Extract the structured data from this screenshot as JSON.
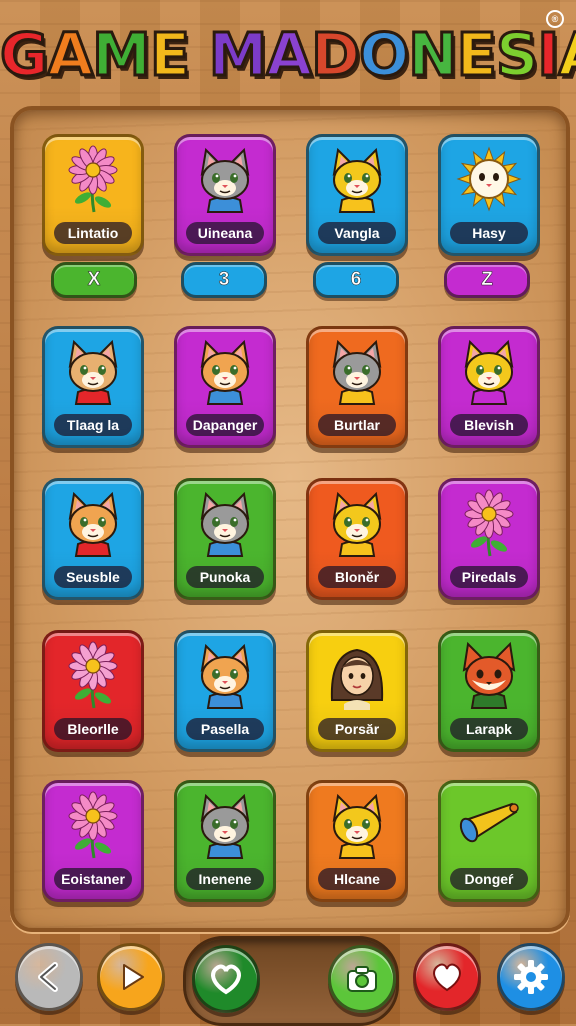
{
  "title": {
    "letters": [
      {
        "ch": "G",
        "color": "#e8262b"
      },
      {
        "ch": "A",
        "color": "#f07d1e"
      },
      {
        "ch": "M",
        "color": "#3fae35"
      },
      {
        "ch": "E",
        "color": "#f2b81b"
      },
      {
        "ch": " ",
        "color": "#000000"
      },
      {
        "ch": "M",
        "color": "#7c3cc8"
      },
      {
        "ch": "A",
        "color": "#8a42d0"
      },
      {
        "ch": "D",
        "color": "#d8472c"
      },
      {
        "ch": "O",
        "color": "#3c8fd9"
      },
      {
        "ch": "N",
        "color": "#47b640"
      },
      {
        "ch": "E",
        "color": "#f2b81b"
      },
      {
        "ch": "S",
        "color": "#7ccf2f"
      },
      {
        "ch": "I",
        "color": "#e8262b"
      },
      {
        "ch": "A",
        "color": "#f2cf1b"
      }
    ],
    "mark": "®"
  },
  "tiles": [
    {
      "label": "Lintatio",
      "color": "#f7b41c",
      "icon": "flower-icon"
    },
    {
      "label": "Uineana",
      "color": "#c42bd0",
      "icon": "cat-icon"
    },
    {
      "label": "Vangla",
      "color": "#1ea5e4",
      "icon": "cat-icon"
    },
    {
      "label": "Hasy",
      "color": "#1ea5e4",
      "icon": "sun-cat-icon"
    },
    {
      "label": "Tlaag la",
      "color": "#1ea5e4",
      "icon": "cat-icon"
    },
    {
      "label": "Dapanger",
      "color": "#c42bd0",
      "icon": "cat-icon"
    },
    {
      "label": "Burtlar",
      "color": "#ef6a1f",
      "icon": "cat-icon"
    },
    {
      "label": "Blevish",
      "color": "#c42bd0",
      "icon": "cat-icon"
    },
    {
      "label": "Seusble",
      "color": "#1ea5e4",
      "icon": "cat-icon"
    },
    {
      "label": "Punoka",
      "color": "#4bb52e",
      "icon": "cat-icon"
    },
    {
      "label": "Bloněr",
      "color": "#ef5a1f",
      "icon": "cat-icon"
    },
    {
      "label": "Piredals",
      "color": "#c42bd0",
      "icon": "flower-icon"
    },
    {
      "label": "Bleorlle",
      "color": "#e3262a",
      "icon": "flower-icon"
    },
    {
      "label": "Pasella",
      "color": "#1ea5e4",
      "icon": "cat-icon"
    },
    {
      "label": "Porsăr",
      "color": "#f7cf10",
      "icon": "girl-icon"
    },
    {
      "label": "Larapk",
      "color": "#4bb52e",
      "icon": "fox-icon"
    },
    {
      "label": "Eoistaner",
      "color": "#c42bd0",
      "icon": "flower-icon"
    },
    {
      "label": "Inenene",
      "color": "#4bb52e",
      "icon": "cat-icon"
    },
    {
      "label": "Hlcane",
      "color": "#ef7a1f",
      "icon": "cat-icon"
    },
    {
      "label": "Dongeŕ",
      "color": "#6cc72a",
      "icon": "horn-icon"
    }
  ],
  "badges": [
    {
      "text": "X",
      "color": "#4bb52e"
    },
    {
      "text": "3",
      "color": "#1ea5e4"
    },
    {
      "text": "6",
      "color": "#1ea5e4"
    },
    {
      "text": "Z",
      "color": "#c42bd0"
    }
  ],
  "buttons": [
    {
      "name": "back-button",
      "icon": "chevron-left-icon",
      "color": "#b9b9b9"
    },
    {
      "name": "play-button",
      "icon": "play-icon",
      "color": "#f7a51c"
    },
    {
      "name": "heart-button",
      "icon": "heart-outline-icon",
      "color": "#1f8a2a"
    },
    {
      "name": "camera-button",
      "icon": "camera-icon",
      "color": "#5cc63a"
    },
    {
      "name": "favorite-button",
      "icon": "heart-icon",
      "color": "#e3262a"
    },
    {
      "name": "settings-button",
      "icon": "gear-icon",
      "color": "#1e8fe4"
    }
  ]
}
